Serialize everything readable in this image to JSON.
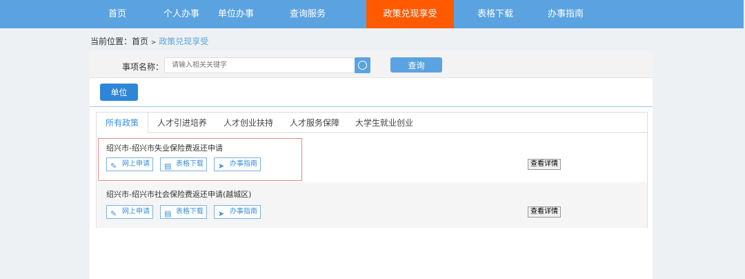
{
  "nav": [
    "首页",
    "个人办事",
    "单位办事",
    "查询服务",
    "政策兑现享受",
    "表格下载",
    "办事指南"
  ],
  "breadcrumb": {
    "prefix": "当前位置：",
    "home": "首页",
    "sep": ">",
    "current": "政策兑现享受"
  },
  "search": {
    "label": "事项名称：",
    "placeholder": "请输入相关关键字",
    "query": "查询"
  },
  "unit_button": "单位",
  "tabs": [
    "所有政策",
    "人才引进培养",
    "人才创业扶持",
    "人才服务保障",
    "大学生就业创业"
  ],
  "items": [
    {
      "title": "绍兴市-绍兴市失业保险费返还申请",
      "apply": "网上申请",
      "download": "表格下载",
      "guide": "办事指南",
      "details": "查看详情"
    },
    {
      "title": "绍兴市-绍兴市社会保险费返还申请(越城区)",
      "apply": "网上申请",
      "download": "表格下载",
      "guide": "办事指南",
      "details": "查看详情"
    }
  ]
}
